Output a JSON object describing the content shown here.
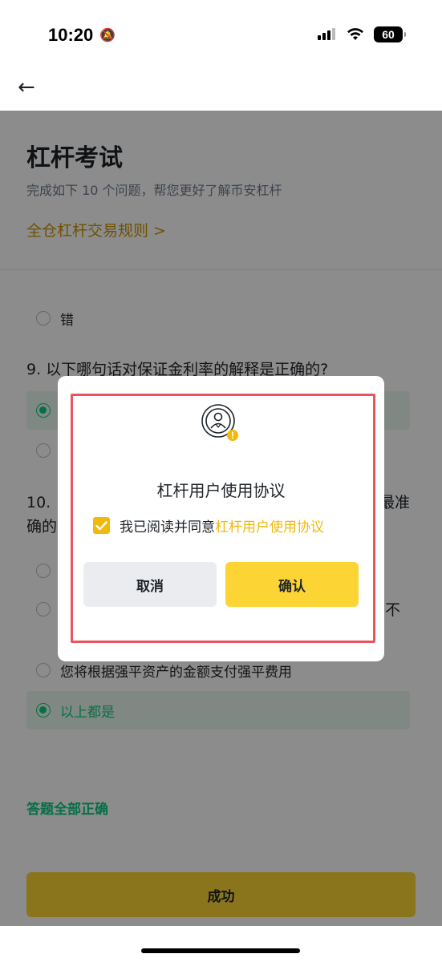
{
  "status_bar": {
    "time": "10:20",
    "battery": "60"
  },
  "page": {
    "title": "杠杆考试",
    "subtitle": "完成如下 10 个问题，帮您更好了解币安杠杆",
    "rules_link": "全仓杠杆交易规则 >"
  },
  "quiz": {
    "q8_option_false": "错",
    "q9": "9. 以下哪句话对保证金利率的解释是正确的?",
    "q10_fragment_a": "10.",
    "q10_fragment_b": "最准",
    "q10_fragment_c": "确的",
    "q10_fragment_d": "不",
    "q10_option_c": "您将根据强平资产的金额支付强平费用",
    "q10_option_d": "以上都是",
    "result": "答题全部正确",
    "submit_label": "成功"
  },
  "dialog": {
    "title": "杠杆用户使用协议",
    "agree_prefix": "我已阅读并同意",
    "agree_link": "杠杆用户使用协议",
    "cancel_label": "取消",
    "confirm_label": "确认"
  },
  "colors": {
    "accent": "#fcd535",
    "link": "#f0b90b",
    "success": "#0ecb81",
    "highlight_frame": "#e9555f"
  }
}
